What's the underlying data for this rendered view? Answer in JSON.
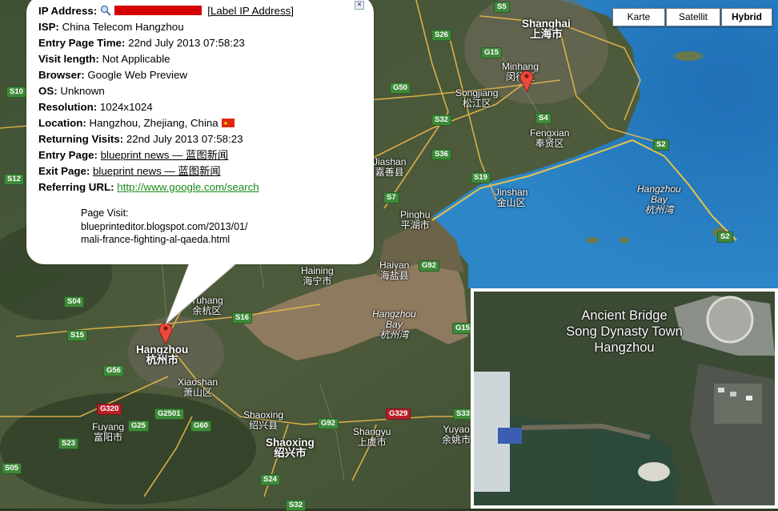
{
  "map_type": {
    "buttons": [
      "Karte",
      "Satellit",
      "Hybrid"
    ],
    "selected": "Hybrid"
  },
  "info": {
    "ip_label": "IP Address:",
    "ip_link": "[Label IP Address]",
    "isp_label": "ISP:",
    "isp_value": "China Telecom Hangzhou",
    "entry_time_label": "Entry Page Time:",
    "entry_time_value": "22nd July 2013 07:58:23",
    "visit_length_label": "Visit length:",
    "visit_length_value": "Not Applicable",
    "browser_label": "Browser:",
    "browser_value": "Google Web Preview",
    "os_label": "OS:",
    "os_value": "Unknown",
    "resolution_label": "Resolution:",
    "resolution_value": "1024x1024",
    "location_label": "Location:",
    "location_value": "Hangzhou, Zhejiang, China",
    "returning_label": "Returning Visits:",
    "returning_value": "22nd July 2013 07:58:23",
    "entry_page_label": "Entry Page:",
    "entry_page_value": "blueprint news — 蓝图新闻",
    "exit_page_label": "Exit Page:",
    "exit_page_value": "blueprint news — 蓝图新闻",
    "referring_label": "Referring URL:",
    "referring_value": "http://www.google.com/search",
    "page_visit_label": "Page Visit:",
    "page_visit_line1": "blueprinteditor.blogspot.com/2013/01/",
    "page_visit_line2": "mali-france-fighting-al-qaeda.html"
  },
  "inset": {
    "caption_line1": "Ancient Bridge",
    "caption_line2": "Song Dynasty Town",
    "caption_line3": "Hangzhou"
  },
  "places": {
    "shanghai_en": "Shanghai",
    "shanghai_cn": "上海市",
    "hangzhou_en": "Hangzhou",
    "hangzhou_cn": "杭州市",
    "shaoxing_en": "Shaoxing",
    "shaoxing_cn": "绍兴市",
    "minhang_en": "Minhang",
    "minhang_cn": "闵行区",
    "songjiang_en": "Songjiang",
    "songjiang_cn": "松江区",
    "fengxian_en": "Fengxian",
    "fengxian_cn": "奉贤区",
    "jinshan_en": "Jinshan",
    "jinshan_cn": "金山区",
    "jiashan_en": "Jiashan",
    "jiashan_cn": "嘉善县",
    "pinghu_en": "Pinghu",
    "pinghu_cn": "平湖市",
    "haining_en": "Haining",
    "haining_cn": "海宁市",
    "haiyan_en": "Haiyan",
    "haiyan_cn": "海盐县",
    "yuhang_en": "Yuhang",
    "yuhang_cn": "余杭区",
    "xiaoshan_en": "Xiaoshan",
    "xiaoshan_cn": "萧山区",
    "fuyang_en": "Fuyang",
    "fuyang_cn": "富阳市",
    "shaoxing2_en": "Shaoxing",
    "shaoxing2_cn": "绍兴县",
    "shangyu_en": "Shangyu",
    "shangyu_cn": "上虞市",
    "yuyao_en": "Yuyao",
    "yuyao_cn": "余姚市",
    "hzbay1_en": "Hangzhou",
    "hzbay1_b": "Bay",
    "hzbay1_cn": "杭州湾",
    "hzbay2_en": "Hangzhou",
    "hzbay2_b": "Bay",
    "hzbay2_cn": "杭州湾"
  },
  "shields": [
    "S5",
    "S26",
    "G15",
    "G50",
    "S10",
    "S32",
    "S4",
    "S2",
    "S36",
    "S19",
    "S12",
    "S7",
    "G92",
    "S2",
    "S04",
    "S16",
    "S15",
    "G15",
    "G56",
    "G320",
    "G2501",
    "G25",
    "G60",
    "S23",
    "S33",
    "G92",
    "G329",
    "S24",
    "S32",
    "S05"
  ]
}
